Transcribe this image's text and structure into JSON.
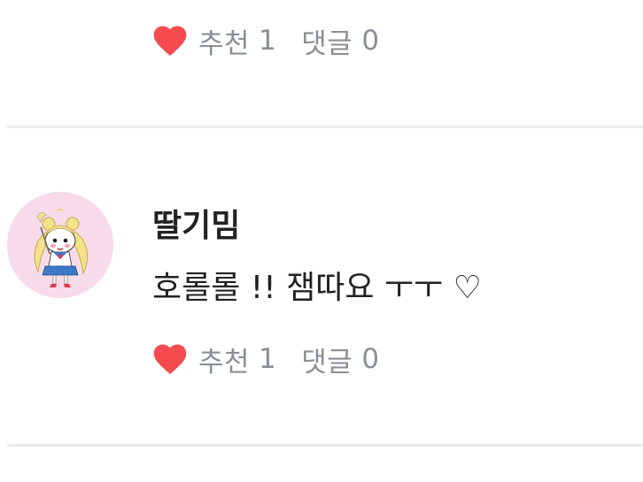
{
  "top_item": {
    "like_label": "추천",
    "like_count": "1",
    "reply_label": "댓글",
    "reply_count": "0"
  },
  "comment": {
    "username": "딸기밈",
    "text": "호롤롤 !! 잼따요 ㅜㅜ ♡",
    "like_label": "추천",
    "like_count": "1",
    "reply_label": "댓글",
    "reply_count": "0"
  },
  "colors": {
    "heart": "#f44b4f",
    "meta_text": "#8a8f94",
    "divider": "#e9ecef",
    "avatar_bg": "#f7dbe8"
  },
  "icons": {
    "like": "heart-icon",
    "avatar": "sailor-character-avatar"
  }
}
